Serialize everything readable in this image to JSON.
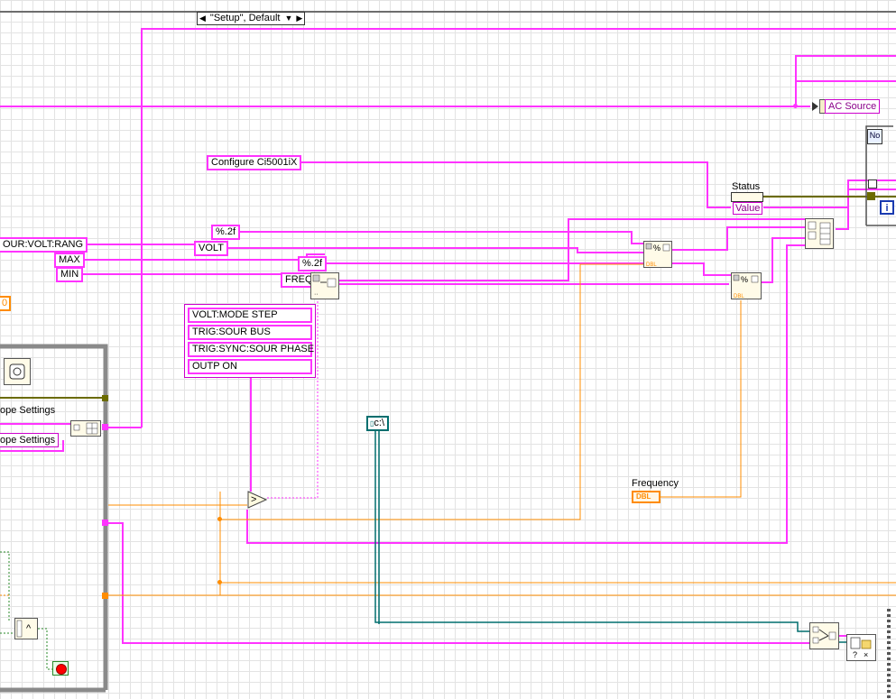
{
  "case_selector": {
    "value": "\"Setup\", Default",
    "left_arrow": "◀",
    "right_arrow": "▶",
    "dropdown": "▼"
  },
  "labels": {
    "ac_source": "AC Source",
    "status": "Status",
    "status_value": "Value",
    "frequency": "Frequency",
    "dbl": "DBL",
    "scope_settings_1": "ope Settings",
    "scope_settings_2": "ope Settings"
  },
  "constants": {
    "configure": "Configure Ci5001iX",
    "fmt_1": "%.2f",
    "fmt_2": "%.2f",
    "volt": "VOLT",
    "freq": "FREQ",
    "sour_volt_rang": "OUR:VOLT:RANG",
    "max": "MAX",
    "min": "MIN",
    "path": "c:\\",
    "orange_const": "0"
  },
  "command_array": [
    "VOLT:MODE STEP",
    "TRIG:SOUR BUS",
    "TRIG:SYNC:SOUR PHASE",
    "OUTP ON"
  ],
  "icons": {
    "no_error": "No",
    "info": "i",
    "greater_than": ">",
    "compare": "^"
  },
  "colors": {
    "string_wire": "#ff33ff",
    "string_border": "#cc00cc",
    "numeric_wire": "#ff8c00",
    "path_wire": "#006e6e",
    "cluster_wire": "#6b6b00",
    "grid": "#e3e3e3",
    "structure_gray": "#8a8a8a",
    "stop_red": "#ff0000"
  }
}
